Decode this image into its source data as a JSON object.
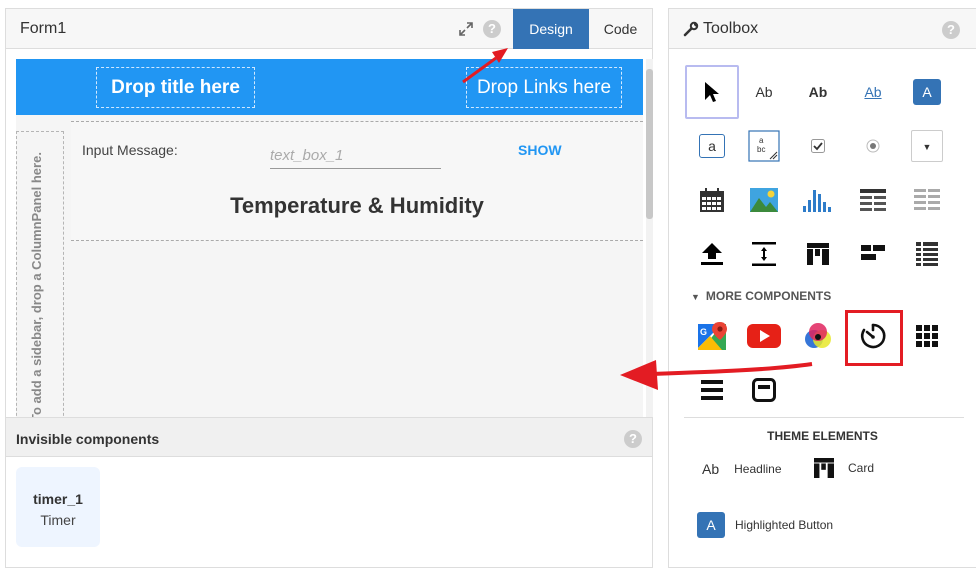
{
  "form": {
    "title": "Form1",
    "tabs": {
      "design": "Design",
      "code": "Code"
    },
    "help": "?"
  },
  "canvas": {
    "drop_title": "Drop title here",
    "drop_links": "Drop Links here",
    "sidebar_hint": "To add a sidebar, drop a ColumnPanel here.",
    "input_label": "Input Message:",
    "input_placeholder": "text_box_1",
    "show_button": "SHOW",
    "heading": "Temperature & Humidity"
  },
  "invisible": {
    "title": "Invisible components",
    "component": {
      "name": "timer_1",
      "type": "Timer"
    }
  },
  "toolbox": {
    "title": "Toolbox",
    "labels": {
      "ab": "Ab",
      "a": "A",
      "text_box": "a",
      "text_area": "a\nbc"
    },
    "more_components": "MORE COMPONENTS",
    "theme_title": "THEME ELEMENTS",
    "theme_items": {
      "headline_icon": "Ab",
      "headline": "Headline",
      "card": "Card",
      "highlighted_icon": "A",
      "highlighted_button": "Highlighted Button"
    }
  },
  "colors": {
    "design_tab": "#3473b5",
    "title_bar": "#2196f3",
    "highlight": "#e31c23",
    "link_blue": "#2196f3"
  }
}
